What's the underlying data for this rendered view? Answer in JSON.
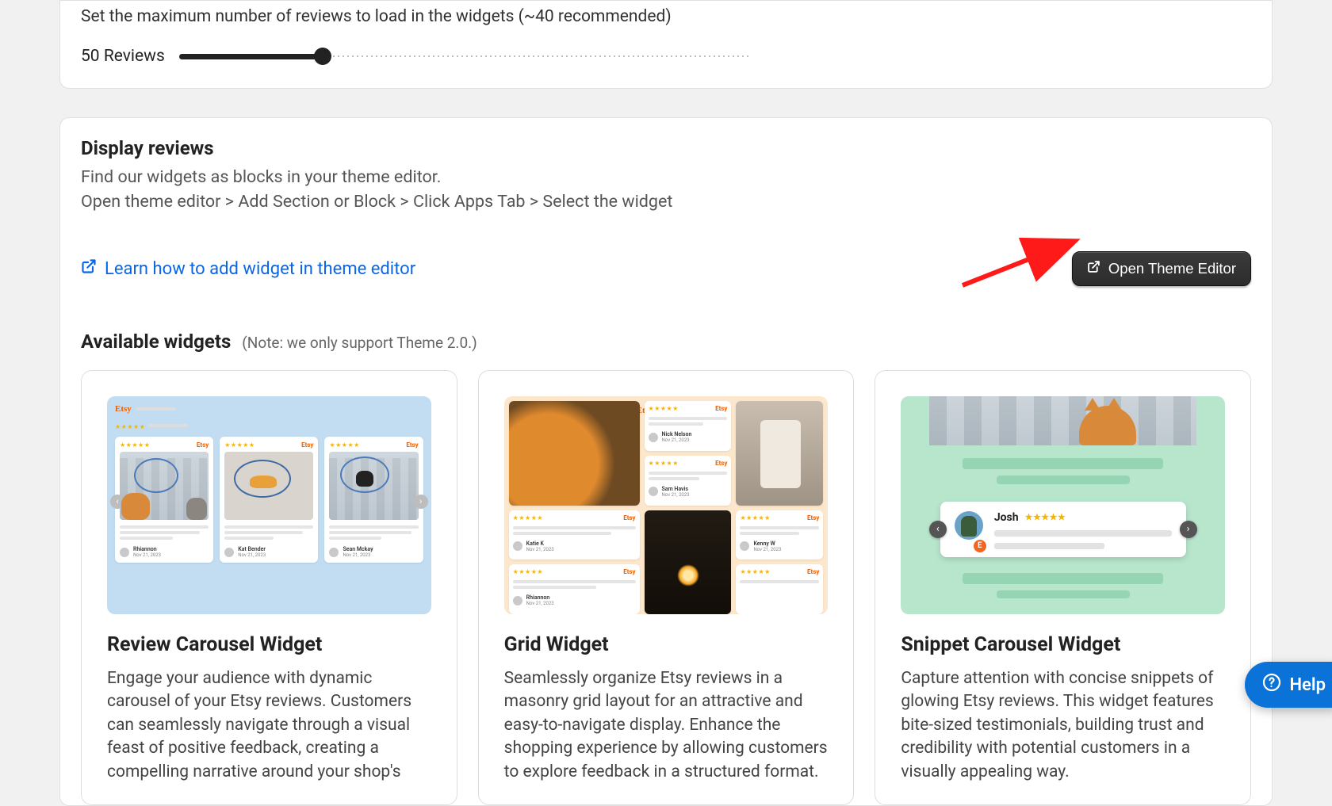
{
  "settings": {
    "max_reviews_desc": "Set the maximum number of reviews to load in the widgets (~40 recommended)",
    "slider_label": "50 Reviews",
    "slider_value": 50,
    "slider_max": 200
  },
  "display": {
    "title": "Display reviews",
    "subtitle1": "Find our widgets as blocks in your theme editor.",
    "subtitle2": "Open theme editor > Add Section or Block > Click Apps Tab > Select the widget",
    "learn_link": "Learn how to add widget in theme editor",
    "open_editor_btn": "Open Theme Editor"
  },
  "available": {
    "title": "Available widgets",
    "note": "(Note: we only support Theme 2.0.)"
  },
  "widgets": [
    {
      "title": "Review Carousel Widget",
      "desc": "Engage your audience with dynamic carousel of your Etsy reviews. Customers can seamlessly navigate through a visual feast of positive feedback, creating a compelling narrative around your shop's",
      "preview_reviewers": [
        "Rhiannon",
        "Kat Bender",
        "Sean Mckay"
      ],
      "preview_date": "Nov 21, 2023"
    },
    {
      "title": "Grid Widget",
      "desc": "Seamlessly organize Etsy reviews in a masonry grid layout for an attractive and easy-to-navigate display. Enhance the shopping experience by allowing customers to explore feedback in a structured format.",
      "preview_reviewers": [
        "Nick Nelson",
        "Sam Havis",
        "Katie K",
        "Rhiannon",
        "Kenny W"
      ],
      "preview_date": "Nov 21, 2023"
    },
    {
      "title": "Snippet Carousel Widget",
      "desc": "Capture attention with concise snippets of glowing Etsy reviews. This widget features bite-sized testimonials, building trust and credibility with potential customers in a visually appealing way.",
      "preview_reviewer": "Josh"
    }
  ],
  "help_label": "Help",
  "colors": {
    "link": "#0a66e6",
    "accent_arrow": "#ff1a1a",
    "help_bg": "#0b72d7"
  }
}
